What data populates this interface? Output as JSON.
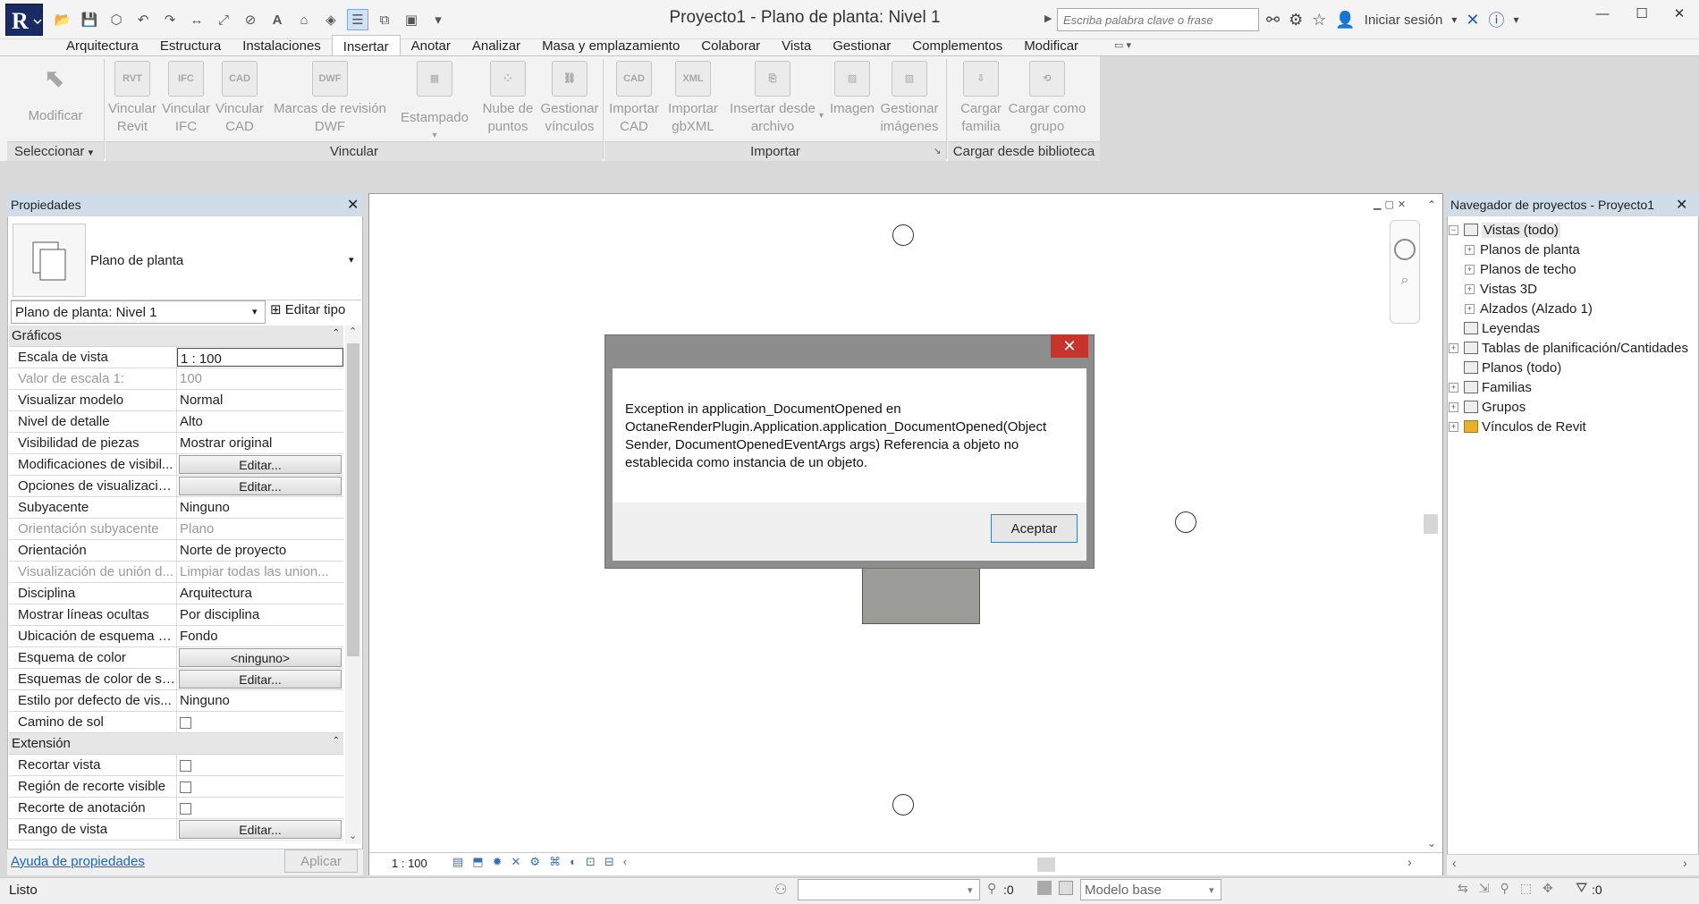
{
  "window": {
    "title": "Proyecto1 - Plano de planta: Nivel 1"
  },
  "search": {
    "placeholder": "Escriba palabra clave o frase"
  },
  "header": {
    "signin": "Iniciar sesión"
  },
  "tabs": [
    "Arquitectura",
    "Estructura",
    "Instalaciones",
    "Insertar",
    "Anotar",
    "Analizar",
    "Masa y emplazamiento",
    "Colaborar",
    "Vista",
    "Gestionar",
    "Complementos",
    "Modificar"
  ],
  "ribbon": {
    "tools": {
      "modificar": "Modificar",
      "vincular_revit": "Vincular Revit",
      "vincular_ifc": "Vincular IFC",
      "vincular_cad": "Vincular CAD",
      "marcas_dwf": "Marcas de revisión DWF",
      "estampado": "Estampado",
      "nube_puntos": "Nube de puntos",
      "gestionar_vinculos": "Gestionar vínculos",
      "importar_cad": "Importar CAD",
      "importar_gbxml": "Importar gbXML",
      "insertar_archivo": "Insertar desde archivo",
      "imagen": "Imagen",
      "gestionar_imagenes": "Gestionar imágenes",
      "cargar_familia": "Cargar familia",
      "cargar_grupo": "Cargar como grupo"
    },
    "panels": {
      "seleccionar": "Seleccionar",
      "vincular": "Vincular",
      "importar": "Importar",
      "cargar": "Cargar desde biblioteca"
    }
  },
  "properties": {
    "title": "Propiedades",
    "type_name": "Plano de planta",
    "selector": "Plano de planta: Nivel 1",
    "edit_type": "Editar tipo",
    "group_graficos": "Gráficos",
    "group_extension": "Extensión",
    "rows": [
      {
        "name": "Escala de vista",
        "value": "1 : 100"
      },
      {
        "name": "Valor de escala    1:",
        "value": "100"
      },
      {
        "name": "Visualizar modelo",
        "value": "Normal"
      },
      {
        "name": "Nivel de detalle",
        "value": "Alto"
      },
      {
        "name": "Visibilidad de piezas",
        "value": "Mostrar original"
      },
      {
        "name": "Modificaciones de visibil...",
        "value": "Editar..."
      },
      {
        "name": "Opciones de visualizació...",
        "value": "Editar..."
      },
      {
        "name": "Subyacente",
        "value": "Ninguno"
      },
      {
        "name": "Orientación subyacente",
        "value": "Plano"
      },
      {
        "name": "Orientación",
        "value": "Norte de proyecto"
      },
      {
        "name": "Visualización de unión d...",
        "value": "Limpiar todas las union..."
      },
      {
        "name": "Disciplina",
        "value": "Arquitectura"
      },
      {
        "name": "Mostrar líneas ocultas",
        "value": "Por disciplina"
      },
      {
        "name": "Ubicación de esquema d...",
        "value": "Fondo"
      },
      {
        "name": "Esquema de color",
        "value": "<ninguno>"
      },
      {
        "name": "Esquemas de color de sis...",
        "value": "Editar..."
      },
      {
        "name": "Estilo por defecto de vis...",
        "value": "Ninguno"
      },
      {
        "name": "Camino de sol",
        "value": ""
      }
    ],
    "ext_rows": [
      {
        "name": "Recortar vista",
        "value": ""
      },
      {
        "name": "Región de recorte visible",
        "value": ""
      },
      {
        "name": "Recorte de anotación",
        "value": ""
      },
      {
        "name": "Rango de vista",
        "value": "Editar..."
      }
    ],
    "help": "Ayuda de propiedades",
    "apply": "Aplicar"
  },
  "view": {
    "scale": "1 : 100"
  },
  "browser": {
    "title": "Navegador de proyectos - Proyecto1",
    "items": [
      {
        "label": "Vistas (todo)"
      },
      {
        "label": "Planos de planta"
      },
      {
        "label": "Planos de techo"
      },
      {
        "label": "Vistas 3D"
      },
      {
        "label": "Alzados (Alzado 1)"
      },
      {
        "label": "Leyendas"
      },
      {
        "label": "Tablas de planificación/Cantidades"
      },
      {
        "label": "Planos (todo)"
      },
      {
        "label": "Familias"
      },
      {
        "label": "Grupos"
      },
      {
        "label": "Vínculos de Revit"
      }
    ]
  },
  "status": {
    "text": "Listo",
    "worksets": ":0",
    "model": "Modelo base",
    "filter": ":0"
  },
  "dialog": {
    "message": "Exception in application_DocumentOpened    en OctaneRenderPlugin.Application.application_DocumentOpened(Object Sender, DocumentOpenedEventArgs args) Referencia a objeto no establecida como instancia de un objeto.",
    "ok": "Aceptar"
  },
  "colors": {
    "accent": "#1a2a62",
    "close": "#c8332b"
  }
}
